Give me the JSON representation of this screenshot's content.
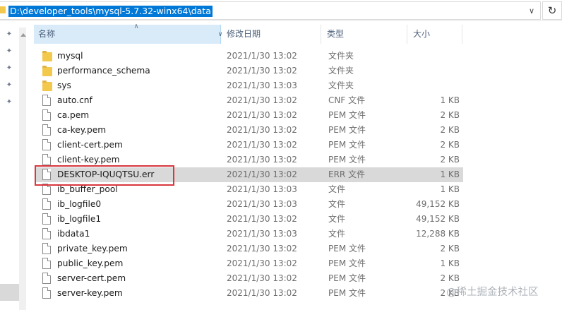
{
  "address": {
    "path": "D:\\developer_tools\\mysql-5.7.32-winx64\\data",
    "dropdown_icon": "chevron-down-icon",
    "refresh_icon": "refresh-icon"
  },
  "columns": {
    "name": "名称",
    "date": "修改日期",
    "type": "类型",
    "size": "大小"
  },
  "files": [
    {
      "name": "mysql",
      "date": "2021/1/30 13:02",
      "type": "文件夹",
      "size": "",
      "icon": "folder-icon"
    },
    {
      "name": "performance_schema",
      "date": "2021/1/30 13:02",
      "type": "文件夹",
      "size": "",
      "icon": "folder-icon"
    },
    {
      "name": "sys",
      "date": "2021/1/30 13:03",
      "type": "文件夹",
      "size": "",
      "icon": "folder-icon"
    },
    {
      "name": "auto.cnf",
      "date": "2021/1/30 13:02",
      "type": "CNF 文件",
      "size": "1 KB",
      "icon": "file-icon"
    },
    {
      "name": "ca.pem",
      "date": "2021/1/30 13:02",
      "type": "PEM 文件",
      "size": "2 KB",
      "icon": "file-icon"
    },
    {
      "name": "ca-key.pem",
      "date": "2021/1/30 13:02",
      "type": "PEM 文件",
      "size": "2 KB",
      "icon": "file-icon"
    },
    {
      "name": "client-cert.pem",
      "date": "2021/1/30 13:02",
      "type": "PEM 文件",
      "size": "2 KB",
      "icon": "file-icon"
    },
    {
      "name": "client-key.pem",
      "date": "2021/1/30 13:02",
      "type": "PEM 文件",
      "size": "2 KB",
      "icon": "file-icon"
    },
    {
      "name": "DESKTOP-IQUQTSU.err",
      "date": "2021/1/30 13:02",
      "type": "ERR 文件",
      "size": "1 KB",
      "icon": "file-icon",
      "selected": true
    },
    {
      "name": "ib_buffer_pool",
      "date": "2021/1/30 13:03",
      "type": "文件",
      "size": "1 KB",
      "icon": "file-icon"
    },
    {
      "name": "ib_logfile0",
      "date": "2021/1/30 13:03",
      "type": "文件",
      "size": "49,152 KB",
      "icon": "file-icon"
    },
    {
      "name": "ib_logfile1",
      "date": "2021/1/30 13:02",
      "type": "文件",
      "size": "49,152 KB",
      "icon": "file-icon"
    },
    {
      "name": "ibdata1",
      "date": "2021/1/30 13:03",
      "type": "文件",
      "size": "12,288 KB",
      "icon": "file-icon"
    },
    {
      "name": "private_key.pem",
      "date": "2021/1/30 13:02",
      "type": "PEM 文件",
      "size": "2 KB",
      "icon": "file-icon"
    },
    {
      "name": "public_key.pem",
      "date": "2021/1/30 13:02",
      "type": "PEM 文件",
      "size": "1 KB",
      "icon": "file-icon"
    },
    {
      "name": "server-cert.pem",
      "date": "2021/1/30 13:02",
      "type": "PEM 文件",
      "size": "2 KB",
      "icon": "file-icon"
    },
    {
      "name": "server-key.pem",
      "date": "2021/1/30 13:02",
      "type": "PEM 文件",
      "size": "2 KB",
      "icon": "file-icon"
    }
  ],
  "watermark": "@稀土掘金技术社区",
  "colors": {
    "address_selection": "#0078d7",
    "header_active": "#d9ebf9",
    "row_selected": "#d9d9d9",
    "highlight_box": "#d9363e",
    "folder": "#f2c94c"
  }
}
